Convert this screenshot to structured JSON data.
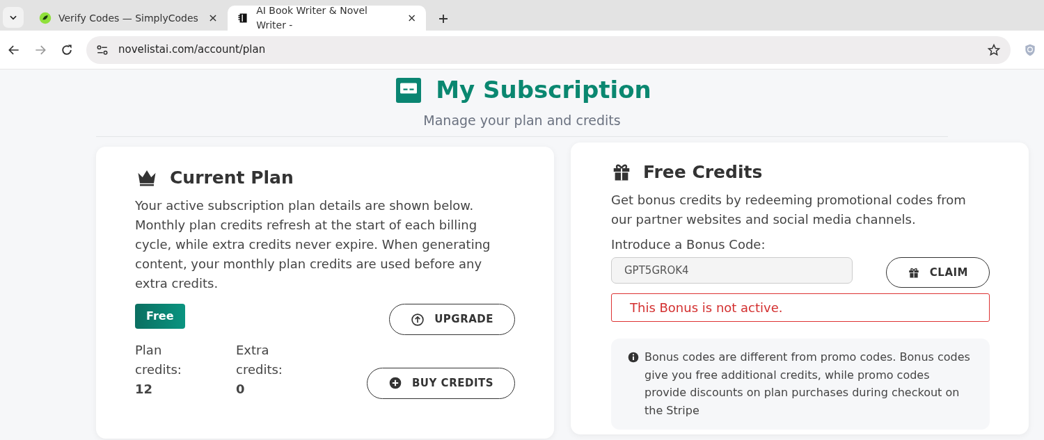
{
  "browser": {
    "tabs": [
      {
        "title": "Verify Codes — SimplyCodes",
        "selected": false
      },
      {
        "title": "AI Book Writer & Novel Writer -",
        "selected": true
      }
    ],
    "url": "novelistai.com/account/plan"
  },
  "header": {
    "title": "My Subscription",
    "subtitle": "Manage your plan and credits"
  },
  "current_plan": {
    "title": "Current Plan",
    "description": "Your active subscription plan details are shown below. Monthly plan credits refresh at the start of each billing cycle, while extra credits never expire. When generating content, your monthly plan credits are used before any extra credits.",
    "plan_badge": "Free",
    "upgrade_button": "UPGRADE",
    "stats": [
      {
        "label": "Plan credits:",
        "value": "12"
      },
      {
        "label": "Extra credits:",
        "value": "0"
      }
    ],
    "buy_button": "BUY CREDITS"
  },
  "free_credits": {
    "title": "Free Credits",
    "description": "Get bonus credits by redeeming promotional codes from our partner websites and social media channels.",
    "field_label": "Introduce a Bonus Code:",
    "code_value": "GPT5GROK4",
    "claim_button": "CLAIM",
    "error": "This Bonus is not active.",
    "info": "Bonus codes are different from promo codes. Bonus codes give you free additional credits, while promo codes provide discounts on plan purchases during checkout on the Stripe"
  }
}
